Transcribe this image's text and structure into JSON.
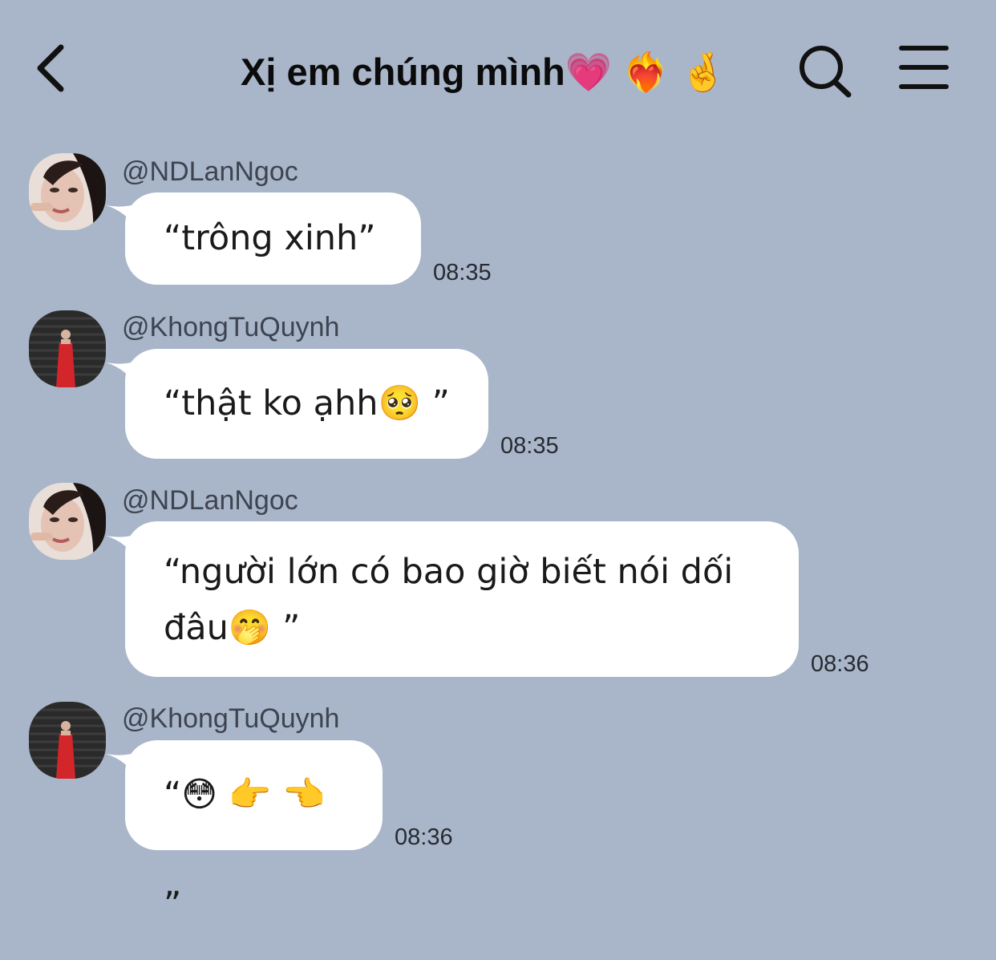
{
  "header": {
    "title": "Xị em chúng mình💗 ❤️‍🔥 🤞",
    "back_icon": "chevron-left-icon",
    "search_icon": "search-icon",
    "menu_icon": "hamburger-menu-icon"
  },
  "colors": {
    "background": "#a9b6c9",
    "bubble": "#ffffff",
    "text": "#1a1a1a",
    "sender": "#3d4450"
  },
  "messages": [
    {
      "sender": "@NDLanNgoc",
      "text": "“trông xinh”",
      "time": "08:35"
    },
    {
      "sender": "@KhongTuQuynh",
      "text": "“thật ko ạhh🥺 ”",
      "time": "08:35"
    },
    {
      "sender": "@NDLanNgoc",
      "text": "“người lớn có bao giờ biết nói dối đâu🤭 ”",
      "time": "08:36"
    },
    {
      "sender": "@KhongTuQuynh",
      "text": "“😳 👉 👈 ”",
      "time": "08:36"
    }
  ]
}
